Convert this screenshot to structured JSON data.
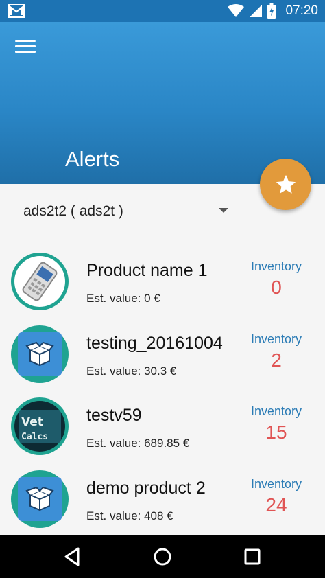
{
  "status_bar": {
    "time": "07:20",
    "icons": [
      "gmail-notification-icon",
      "wifi-icon",
      "signal-icon",
      "battery-charging-icon"
    ]
  },
  "app_bar": {
    "title": "Alerts",
    "menu_icon": "hamburger-menu-icon",
    "fab_icon": "star-icon",
    "gradient": [
      "#3a9ad9",
      "#1f6fa8"
    ]
  },
  "selector": {
    "value": "ads2t2 ( ads2t )",
    "icon": "dropdown-arrow-icon"
  },
  "products": [
    {
      "name": "Product name 1",
      "est_value": "Est. value: 0 €",
      "inventory_label": "Inventory",
      "inventory": "0",
      "image": "mobile-phone-image"
    },
    {
      "name": "testing_20161004",
      "est_value": "Est. value: 30.3 €",
      "inventory_label": "Inventory",
      "inventory": "2",
      "image": "open-box-icon"
    },
    {
      "name": "testv59",
      "est_value": "Est. value: 689.85 €",
      "inventory_label": "Inventory",
      "inventory": "15",
      "image": "vet-calcs-logo",
      "logo_text": [
        "Vet",
        "Calcs"
      ]
    },
    {
      "name": "demo product 2",
      "est_value": "Est. value: 408 €",
      "inventory_label": "Inventory",
      "inventory": "24",
      "image": "open-box-icon"
    }
  ],
  "colors": {
    "accent": "#e29a3b",
    "inventory_label": "#2a7bb5",
    "inventory_value": "#e05454",
    "thumb_ring": "#1fa391"
  },
  "nav_bar": {
    "buttons": [
      "back-icon",
      "home-icon",
      "recents-icon"
    ]
  }
}
